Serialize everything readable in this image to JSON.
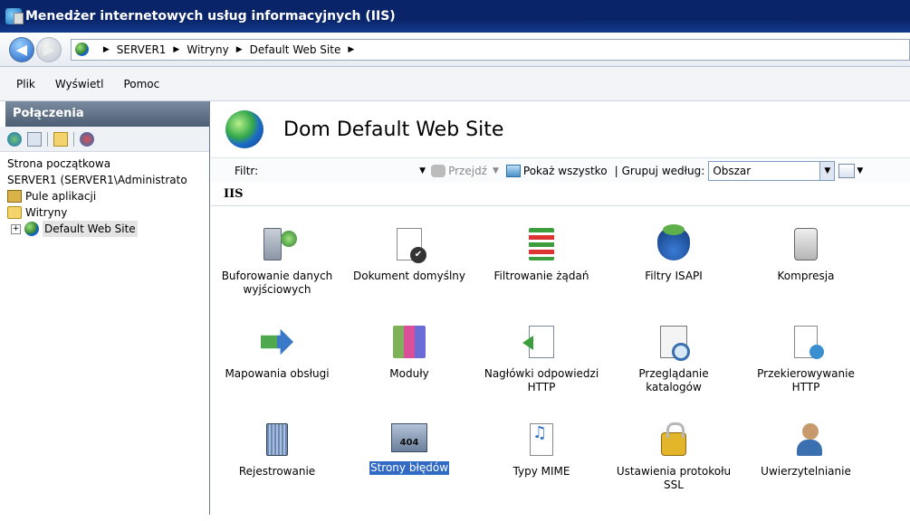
{
  "window": {
    "title": "Menedżer internetowych usług informacyjnych (IIS)"
  },
  "address": {
    "crumbs": [
      "SERVER1",
      "Witryny",
      "Default Web Site"
    ]
  },
  "menu": {
    "items": [
      "Plik",
      "Wyświetl",
      "Pomoc"
    ]
  },
  "connections": {
    "title": "Połączenia",
    "tree": {
      "start": "Strona początkowa",
      "server": "SERVER1 (SERVER1\\Administrato",
      "pools": "Pule aplikacji",
      "sites": "Witryny",
      "site": "Default Web Site"
    }
  },
  "main": {
    "title": "Dom Default Web Site",
    "filter": {
      "label": "Filtr:",
      "go": "Przejdź",
      "show_all": "Pokaż wszystko",
      "group_by": "Grupuj według:",
      "group_value": "Obszar"
    },
    "group": "IIS",
    "features": [
      "Buforowanie danych\nwyjściowych",
      "Dokument domyślny",
      "Filtrowanie żądań",
      "Filtry ISAPI",
      "Kompresja",
      "Mapowania obsługi",
      "Moduły",
      "Nagłówki odpowiedzi\nHTTP",
      "Przeglądanie\nkatalogów",
      "Przekierowywanie\nHTTP",
      "Rejestrowanie",
      "Strony błędów",
      "Typy MIME",
      "Ustawienia protokołu\nSSL",
      "Uwierzytelnianie"
    ],
    "selected_feature": "Strony błędów"
  }
}
